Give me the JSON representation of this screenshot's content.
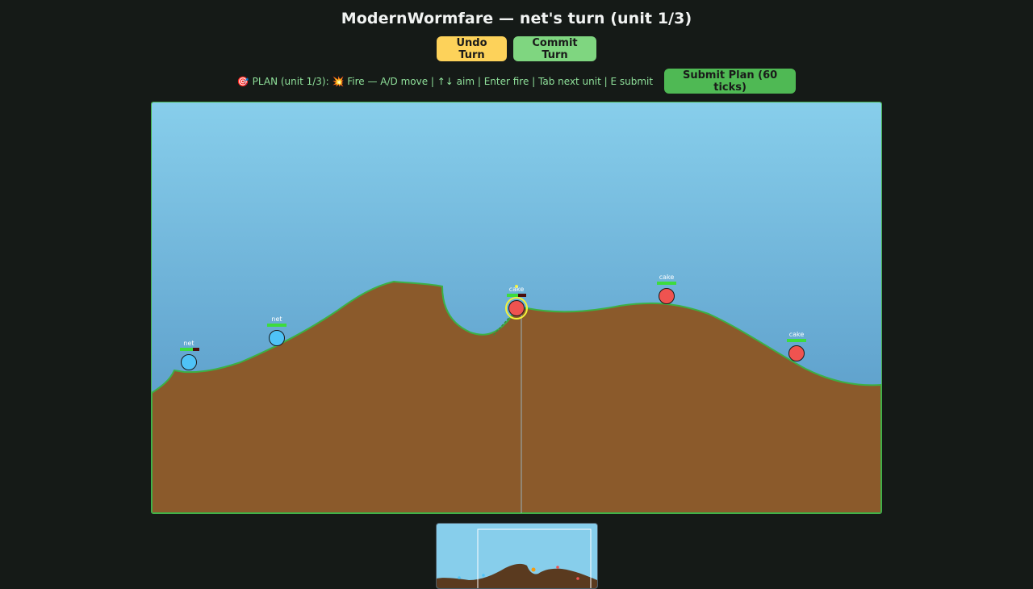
{
  "header": {
    "title": "ModernWormfare — net's turn (unit 1/3)"
  },
  "turn_controls": {
    "undo_label": "Undo Turn",
    "commit_label": "Commit Turn"
  },
  "plan": {
    "instructions": "🎯 PLAN (unit 1/3): 💥 Fire — A/D move | ↑↓ aim | Enter fire | Tab next unit | E submit",
    "submit_label": "Submit Plan (60 ticks)"
  },
  "colors": {
    "sky_top": "#87ceeb",
    "sky_bottom": "#5a9ac8",
    "ground": "#8b5a2b",
    "grass": "#3cb044",
    "team_blue": "#4fc3f7",
    "team_red": "#ef5350",
    "selection": "#f3f33a"
  },
  "units": [
    {
      "team": "net",
      "label": "net",
      "health": 0.65
    },
    {
      "team": "net",
      "label": "net",
      "health": 1.0
    },
    {
      "team": "cake",
      "label": "cake",
      "health": 0.6,
      "selected": true
    },
    {
      "team": "cake",
      "label": "cake",
      "health": 1.0
    },
    {
      "team": "cake",
      "label": "cake",
      "health": 1.0
    }
  ]
}
